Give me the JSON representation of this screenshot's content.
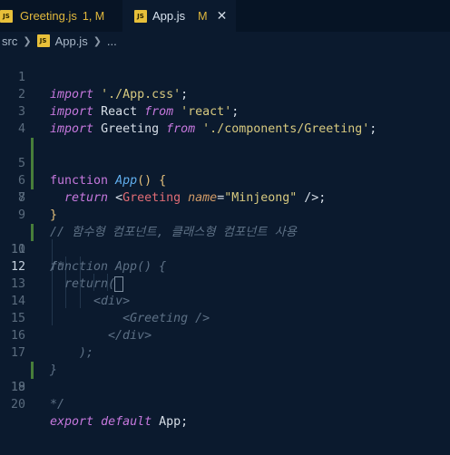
{
  "tabs": [
    {
      "icon": "js-file-icon",
      "icon_text": "JS",
      "name": "Greeting.js",
      "state": "1, M",
      "active": false
    },
    {
      "icon": "js-file-icon",
      "icon_text": "JS",
      "name": "App.js",
      "state": "M",
      "active": true
    }
  ],
  "breadcrumb": {
    "folder": "src",
    "file": "App.js",
    "symbol": "..."
  },
  "editor": {
    "current_line": 12,
    "line_numbers": [
      "1",
      "2",
      "3",
      "4",
      "5",
      "6",
      "7",
      "8",
      "9",
      "10",
      "11",
      "12",
      "13",
      "14",
      "15",
      "16",
      "17",
      "18",
      "19",
      "20"
    ],
    "lines": {
      "l1": {
        "kw": "import",
        "str": "'./App.css'",
        "end": ";"
      },
      "l2": {
        "kw": "import",
        "id": "React",
        "from": "from",
        "str": "'react'",
        "end": ";"
      },
      "l3": {
        "kw": "import",
        "id": "Greeting",
        "from": "from",
        "str": "'./components/Greeting'",
        "end": ";"
      },
      "l5": {
        "kw": "function",
        "name": "App",
        "parens": "()",
        "brace": "{"
      },
      "l6": {
        "kw": "return",
        "open": "<",
        "tag": "Greeting",
        "attr": "name",
        "eq": "=",
        "str": "\"Minjeong\"",
        "close": "/>",
        "end": ";"
      },
      "l7": {
        "brace": "}"
      },
      "l9": {
        "comment": "// 함수형 컴포넌트, 클래스형 컴포넌트 사용"
      },
      "l10": {
        "comment": "/*"
      },
      "l11": {
        "comment": "function App() {"
      },
      "l12": {
        "comment": "return(",
        "cursor": " "
      },
      "l13": {
        "comment": "<div>"
      },
      "l14": {
        "comment": "<Greeting />"
      },
      "l15": {
        "comment": "</div>"
      },
      "l16": {
        "comment": ");"
      },
      "l17": {
        "comment": "}"
      },
      "l18": {
        "comment": "*/"
      },
      "l20": {
        "kw": "export",
        "kw2": "default",
        "id": "App",
        "end": ";"
      }
    }
  }
}
